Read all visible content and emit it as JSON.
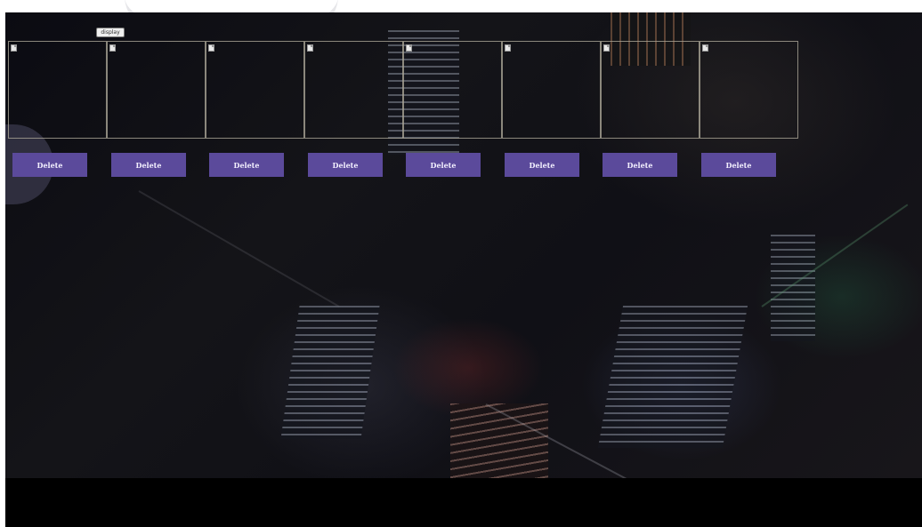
{
  "toolbar": {
    "display_label": "display"
  },
  "frames": [
    {
      "icon": "file-icon"
    },
    {
      "icon": "file-icon"
    },
    {
      "icon": "file-icon"
    },
    {
      "icon": "file-icon"
    },
    {
      "icon": "file-icon"
    },
    {
      "icon": "file-icon"
    },
    {
      "icon": "file-icon"
    },
    {
      "icon": "file-icon"
    }
  ],
  "delete_buttons": [
    "Delete",
    "Delete",
    "Delete",
    "Delete",
    "Delete",
    "Delete",
    "Delete",
    "Delete"
  ],
  "colors": {
    "delete_button_bg": "#5b4a9b",
    "frame_border": "#aaa596",
    "background": "#101016"
  }
}
